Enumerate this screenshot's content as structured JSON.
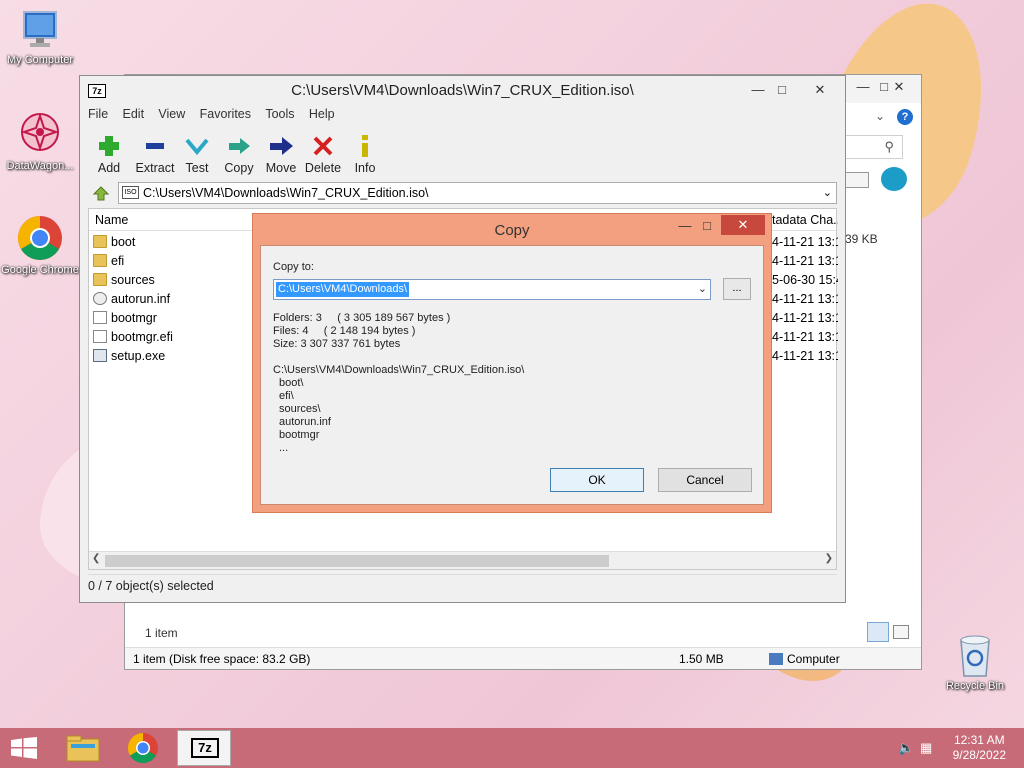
{
  "desktop": {
    "icons": [
      {
        "label": "My Computer"
      },
      {
        "label": "DataWagon..."
      },
      {
        "label": "Google Chrome"
      },
      {
        "label": "Recycle Bin"
      }
    ]
  },
  "explorer_window": {
    "item_count": "1 item",
    "size_label": "39 KB",
    "status_left": "1 item (Disk free space: 83.2 GB)",
    "status_size": "1.50 MB",
    "status_location": "Computer"
  },
  "sevenzip_window": {
    "title": "C:\\Users\\VM4\\Downloads\\Win7_CRUX_Edition.iso\\",
    "app_icon": "7z",
    "menu": [
      "File",
      "Edit",
      "View",
      "Favorites",
      "Tools",
      "Help"
    ],
    "toolbar": [
      {
        "label": "Add",
        "icon": "plus-icon",
        "color": "#2eaa2e"
      },
      {
        "label": "Extract",
        "icon": "minus-icon",
        "color": "#1f3f9c"
      },
      {
        "label": "Test",
        "icon": "check-icon",
        "color": "#2aa9c7"
      },
      {
        "label": "Copy",
        "icon": "copy-arrow-icon",
        "color": "#2aa38a"
      },
      {
        "label": "Move",
        "icon": "move-arrow-icon",
        "color": "#1f2f8c"
      },
      {
        "label": "Delete",
        "icon": "x-icon",
        "color": "#d42020"
      },
      {
        "label": "Info",
        "icon": "info-icon",
        "color": "#c9b600"
      }
    ],
    "address": "C:\\Users\\VM4\\Downloads\\Win7_CRUX_Edition.iso\\",
    "columns": {
      "name": "Name",
      "date": "tadata Cha..."
    },
    "files": [
      {
        "name": "boot",
        "type": "folder",
        "date": "4-11-21 13:1"
      },
      {
        "name": "efi",
        "type": "folder",
        "date": "4-11-21 13:1"
      },
      {
        "name": "sources",
        "type": "folder",
        "date": "5-06-30 15:4"
      },
      {
        "name": "autorun.inf",
        "type": "inf",
        "date": "4-11-21 13:1"
      },
      {
        "name": "bootmgr",
        "type": "file",
        "date": "4-11-21 13:1"
      },
      {
        "name": "bootmgr.efi",
        "type": "file",
        "date": "4-11-21 13:1"
      },
      {
        "name": "setup.exe",
        "type": "exe",
        "date": "4-11-21 13:1"
      }
    ],
    "status": "0 / 7 object(s) selected"
  },
  "copy_dialog": {
    "title": "Copy",
    "copy_to_label": "Copy to:",
    "destination": "C:\\Users\\VM4\\Downloads\\",
    "browse_label": "...",
    "folders_line": "Folders: 3     ( 3 305 189 567 bytes )",
    "files_line": "Files: 4     ( 2 148 194 bytes )",
    "size_line": "Size: 3 307 337 761 bytes",
    "source_path": "C:\\Users\\VM4\\Downloads\\Win7_CRUX_Edition.iso\\",
    "items": [
      "boot\\",
      "efi\\",
      "sources\\",
      "autorun.inf",
      "bootmgr",
      "..."
    ],
    "ok_label": "OK",
    "cancel_label": "Cancel"
  },
  "taskbar": {
    "time": "12:31 AM",
    "date": "9/28/2022",
    "active_app": "7z"
  }
}
